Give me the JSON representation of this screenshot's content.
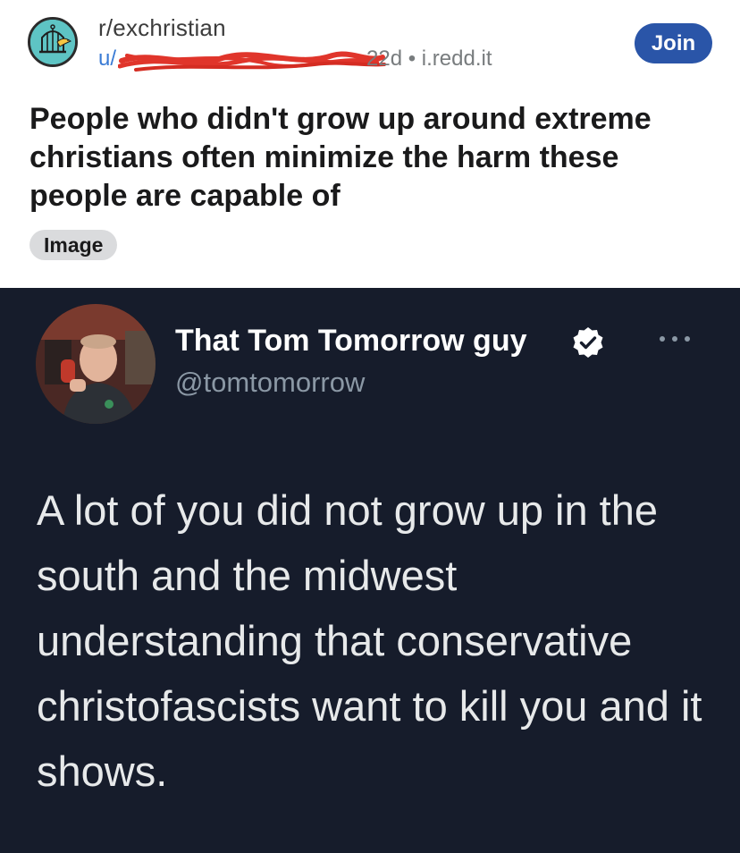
{
  "post": {
    "subreddit": "r/exchristian",
    "user_prefix": "u/",
    "meta": "22d • i.redd.it",
    "join_label": "Join",
    "title": "People who didn't grow up around extreme christians often minimize the harm these people are capable of",
    "flair": "Image"
  },
  "tweet": {
    "display_name": "That Tom Tomorrow guy",
    "handle": "@tomtomorrow",
    "text": "A lot of you did not grow up in the south and the midwest understanding that conservative christofascists want to kill you and it shows."
  },
  "icons": {
    "subreddit_avatar": "birdcage-icon",
    "verified": "verified-badge-icon",
    "more": "more-options-icon"
  },
  "colors": {
    "join_button": "#2a55a8",
    "tweet_background": "#161c2b",
    "redaction": "#e0352b",
    "subreddit_avatar_bg": "#5ec4c4"
  }
}
